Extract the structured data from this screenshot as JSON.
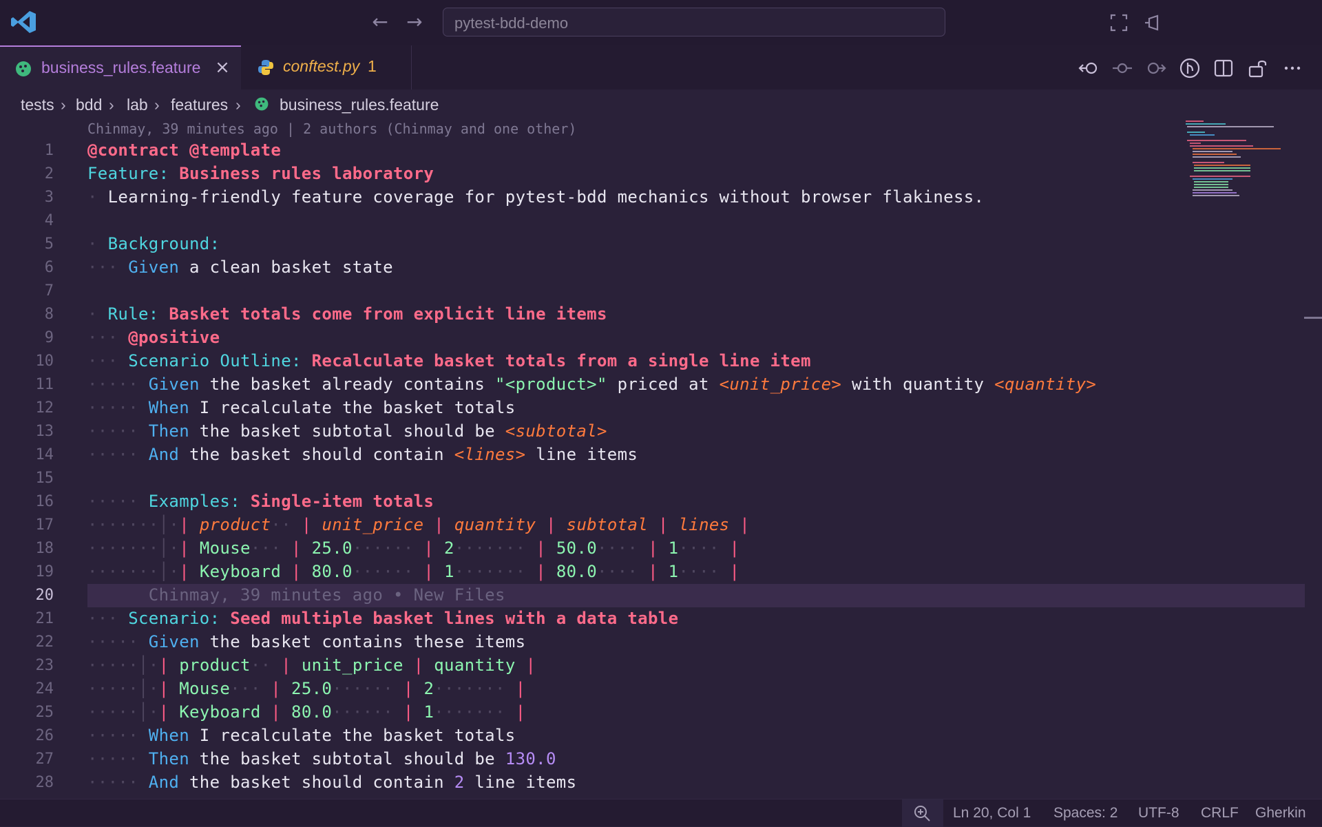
{
  "titlebar": {
    "search_text": "pytest-bdd-demo",
    "back_icon": "arrow-left-icon",
    "forward_icon": "arrow-right-icon"
  },
  "tabs": [
    {
      "label": "business_rules.feature",
      "icon": "cucumber-icon",
      "active": true,
      "close": "×"
    },
    {
      "label": "conftest.py",
      "badge": "1",
      "icon": "python-icon",
      "active": false
    }
  ],
  "breadcrumb": [
    "tests",
    "bdd",
    "lab",
    "features",
    "business_rules.feature"
  ],
  "codelens_top": "Chinmay, 39 minutes ago | 2 authors (Chinmay and one other)",
  "blame_inline": "Chinmay, 39 minutes ago • New Files",
  "line_numbers": [
    "1",
    "2",
    "3",
    "4",
    "5",
    "6",
    "7",
    "8",
    "9",
    "10",
    "11",
    "12",
    "13",
    "14",
    "15",
    "16",
    "17",
    "18",
    "19",
    "20",
    "21",
    "22",
    "23",
    "24",
    "25",
    "26",
    "27",
    "28"
  ],
  "code": {
    "l1": "@contract @template",
    "l2_kw": "Feature:",
    "l2_title": " Business rules laboratory",
    "l3": "Learning-friendly feature coverage for pytest-bdd mechanics without browser flakiness.",
    "l5": "Background:",
    "l6_kw": "Given",
    "l6_text": " a clean basket state",
    "l8_kw": "Rule:",
    "l8_title": " Basket totals come from explicit line items",
    "l9": "@positive",
    "l10_kw": "Scenario Outline:",
    "l10_title": " Recalculate basket totals from a single line item",
    "l11_kw": "Given",
    "l11_a": " the basket already contains ",
    "l11_str": "\"<product>\"",
    "l11_b": " priced at ",
    "l11_ph1": "<unit_price>",
    "l11_c": " with quantity ",
    "l11_ph2": "<quantity>",
    "l12_kw": "When",
    "l12_text": " I recalculate the basket totals",
    "l13_kw": "Then",
    "l13_text": " the basket subtotal should be ",
    "l13_ph": "<subtotal>",
    "l14_kw": "And",
    "l14_a": " the basket should contain ",
    "l14_ph": "<lines>",
    "l14_b": " line items",
    "l16_kw": "Examples:",
    "l16_title": " Single-item totals",
    "t1_headers": [
      "product",
      "unit_price",
      "quantity",
      "subtotal",
      "lines"
    ],
    "t1_rows": [
      [
        "Mouse",
        "25.0",
        "2",
        "50.0",
        "1"
      ],
      [
        "Keyboard",
        "80.0",
        "1",
        "80.0",
        "1"
      ]
    ],
    "l21_kw": "Scenario:",
    "l21_title": " Seed multiple basket lines with a data table",
    "l22_kw": "Given",
    "l22_text": " the basket contains these items",
    "t2_rows": [
      [
        "product",
        "unit_price",
        "quantity"
      ],
      [
        "Mouse",
        "25.0",
        "2"
      ],
      [
        "Keyboard",
        "80.0",
        "1"
      ]
    ],
    "l26_kw": "When",
    "l26_text": " I recalculate the basket totals",
    "l27_kw": "Then",
    "l27_text": " the basket subtotal should be ",
    "l27_num": "130.0",
    "l28_kw": "And",
    "l28_a": " the basket should contain ",
    "l28_num": "2",
    "l28_b": " line items"
  },
  "statusbar": {
    "position": "Ln 20, Col 1",
    "spaces": "Spaces: 2",
    "encoding": "UTF-8",
    "eol": "CRLF",
    "language": "Gherkin"
  },
  "colors": {
    "background": "#2a2139",
    "keyword": "#4fd6e0",
    "title": "#ff6b8a",
    "placeholder": "#ff7a3d",
    "string": "#8cf5b0",
    "number": "#b68cf5",
    "tab_accent": "#b57edc"
  }
}
